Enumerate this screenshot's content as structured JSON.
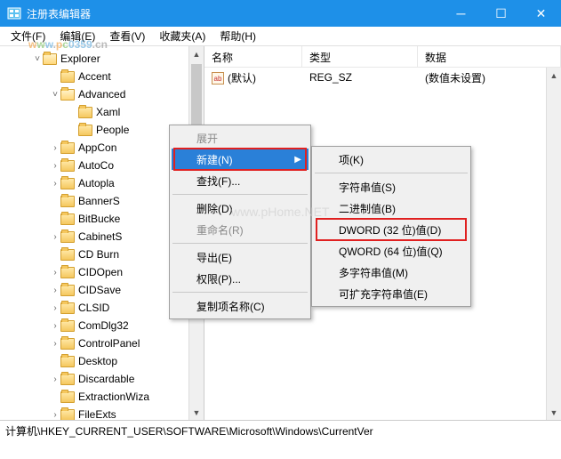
{
  "window": {
    "title": "注册表编辑器"
  },
  "menubar": [
    {
      "label": "文件(F)"
    },
    {
      "label": "编辑(E)"
    },
    {
      "label": "查看(V)"
    },
    {
      "label": "收藏夹(A)"
    },
    {
      "label": "帮助(H)"
    }
  ],
  "list_headers": {
    "name": "名称",
    "type": "类型",
    "data": "数据"
  },
  "list_rows": [
    {
      "name": "(默认)",
      "type": "REG_SZ",
      "data": "(数值未设置)"
    }
  ],
  "tree": [
    {
      "indent": 36,
      "toggle": "v",
      "open": true,
      "label": "Explorer"
    },
    {
      "indent": 56,
      "toggle": "",
      "open": false,
      "label": "Accent"
    },
    {
      "indent": 56,
      "toggle": "v",
      "open": true,
      "label": "Advanced"
    },
    {
      "indent": 76,
      "toggle": "",
      "open": false,
      "label": "Xaml"
    },
    {
      "indent": 76,
      "toggle": "",
      "open": false,
      "label": "People",
      "selected": true
    },
    {
      "indent": 56,
      "toggle": ">",
      "open": false,
      "label": "AppCon"
    },
    {
      "indent": 56,
      "toggle": ">",
      "open": false,
      "label": "AutoCo"
    },
    {
      "indent": 56,
      "toggle": ">",
      "open": false,
      "label": "Autopla"
    },
    {
      "indent": 56,
      "toggle": "",
      "open": false,
      "label": "BannerS"
    },
    {
      "indent": 56,
      "toggle": "",
      "open": false,
      "label": "BitBucke"
    },
    {
      "indent": 56,
      "toggle": ">",
      "open": false,
      "label": "CabinetS"
    },
    {
      "indent": 56,
      "toggle": "",
      "open": false,
      "label": "CD Burn"
    },
    {
      "indent": 56,
      "toggle": ">",
      "open": false,
      "label": "CIDOpen"
    },
    {
      "indent": 56,
      "toggle": ">",
      "open": false,
      "label": "CIDSave"
    },
    {
      "indent": 56,
      "toggle": ">",
      "open": false,
      "label": "CLSID"
    },
    {
      "indent": 56,
      "toggle": ">",
      "open": false,
      "label": "ComDlg32"
    },
    {
      "indent": 56,
      "toggle": ">",
      "open": false,
      "label": "ControlPanel"
    },
    {
      "indent": 56,
      "toggle": "",
      "open": false,
      "label": "Desktop"
    },
    {
      "indent": 56,
      "toggle": ">",
      "open": false,
      "label": "Discardable"
    },
    {
      "indent": 56,
      "toggle": "",
      "open": false,
      "label": "ExtractionWiza"
    },
    {
      "indent": 56,
      "toggle": ">",
      "open": false,
      "label": "FileExts"
    }
  ],
  "context_menu_1": [
    {
      "label": "展开",
      "disabled": true
    },
    {
      "label": "新建(N)",
      "arrow": true,
      "highlighted": true,
      "redbox": true
    },
    {
      "label": "查找(F)...",
      "sep_after": true
    },
    {
      "label": "删除(D)"
    },
    {
      "label": "重命名(R)",
      "disabled": true,
      "sep_after": true
    },
    {
      "label": "导出(E)"
    },
    {
      "label": "权限(P)...",
      "sep_after": true
    },
    {
      "label": "复制项名称(C)"
    }
  ],
  "context_menu_2": [
    {
      "label": "项(K)",
      "sep_after": true
    },
    {
      "label": "字符串值(S)"
    },
    {
      "label": "二进制值(B)"
    },
    {
      "label": "DWORD (32 位)值(D)",
      "redbox": true
    },
    {
      "label": "QWORD (64 位)值(Q)"
    },
    {
      "label": "多字符串值(M)"
    },
    {
      "label": "可扩充字符串值(E)"
    }
  ],
  "statusbar": "计算机\\HKEY_CURRENT_USER\\SOFTWARE\\Microsoft\\Windows\\CurrentVer",
  "watermark": {
    "text": "www.pc0359.cn",
    "center": "www.pHome.NET"
  }
}
